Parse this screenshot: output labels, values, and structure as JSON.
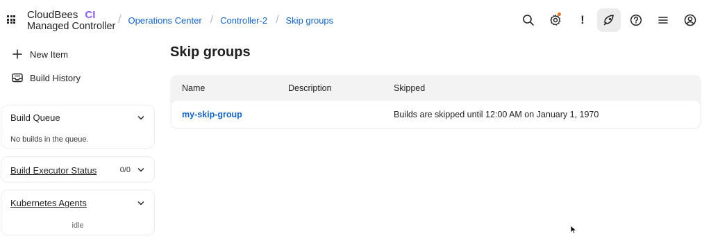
{
  "header": {
    "brand_name": "CloudBees",
    "brand_ci": "CI",
    "brand_subtitle": "Managed Controller",
    "breadcrumbs": [
      {
        "label": "Operations Center"
      },
      {
        "label": "Controller-2"
      },
      {
        "label": "Skip groups"
      }
    ],
    "icons": [
      "search-icon",
      "gear-icon",
      "exclamation-icon",
      "rocket-icon",
      "help-icon",
      "menu-icon",
      "user-icon"
    ],
    "notification_color": "#e8731c"
  },
  "sidebar": {
    "tasks": [
      {
        "label": "New Item",
        "icon": "plus-icon"
      },
      {
        "label": "Build History",
        "icon": "inbox-icon"
      }
    ],
    "build_queue": {
      "title": "Build Queue",
      "body": "No builds in the queue."
    },
    "executor_status": {
      "title": "Build Executor Status",
      "count": "0/0"
    },
    "kubernetes": {
      "title": "Kubernetes Agents",
      "body": "idle"
    }
  },
  "main": {
    "title": "Skip groups",
    "table": {
      "columns": [
        "Name",
        "Description",
        "Skipped"
      ],
      "rows": [
        {
          "name": "my-skip-group",
          "description": "",
          "skipped": "Builds are skipped until 12:00 AM on January 1, 1970"
        }
      ]
    }
  },
  "colors": {
    "link": "#1565c0",
    "accent": "#8b5cf6"
  }
}
